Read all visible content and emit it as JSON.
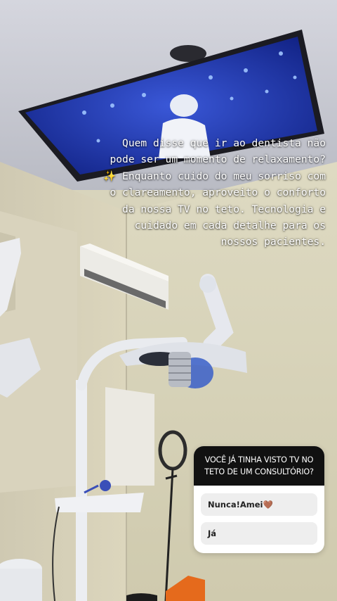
{
  "story": {
    "caption": {
      "line1": "Quem disse que ir ao dentista não",
      "line2": "pode ser um momento de relaxamento?",
      "line3": "✨ Enquanto cuido do meu sorriso com",
      "line4": "o clareamento, aproveito o conforto",
      "line5": "da nossa TV no teto. Tecnologia e",
      "line6": "cuidado em cada detalhe para os",
      "line7": "nossos pacientes."
    },
    "poll": {
      "question": "VOCÊ JÁ TINHA VISTO TV NO TETO DE UM CONSULTÓRIO?",
      "options": [
        "Nunca!Amei🤎",
        "Já"
      ]
    }
  },
  "colors": {
    "ceiling": "#c9cbd3",
    "wall": "#d8d4b8",
    "tv_screen": "#1a2fa0",
    "poll_header": "#111111"
  }
}
